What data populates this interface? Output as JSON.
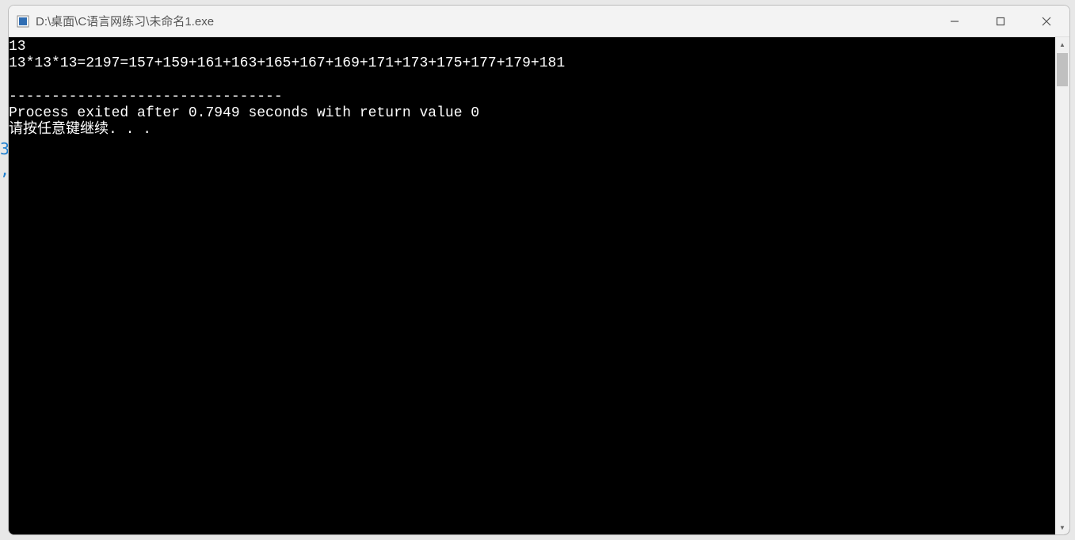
{
  "behind": {
    "line1": "3",
    "line2": ","
  },
  "window": {
    "title": "D:\\桌面\\C语言网练习\\未命名1.exe"
  },
  "console": {
    "lines": [
      "13",
      "13*13*13=2197=157+159+161+163+165+167+169+171+173+175+177+179+181",
      "",
      "--------------------------------",
      "Process exited after 0.7949 seconds with return value 0",
      "请按任意键继续. . ."
    ]
  }
}
